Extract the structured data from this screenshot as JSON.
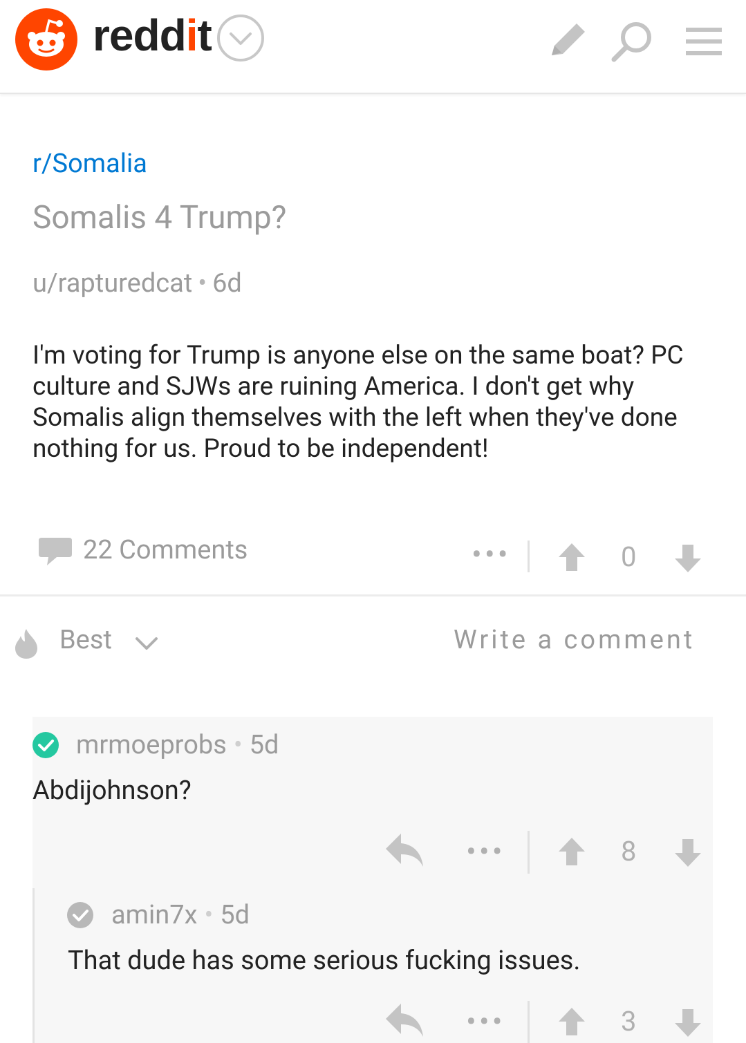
{
  "header": {
    "logo_alt": "reddit",
    "wordmark_main": "redd",
    "wordmark_i": "i",
    "wordmark_t": "t",
    "icons": [
      "reddit-alien-logo",
      "chevron-down-icon",
      "pencil-icon",
      "search-icon",
      "menu-icon"
    ]
  },
  "post": {
    "subreddit": "r/Somalia",
    "title": "Somalis 4 Trump?",
    "author": "u/rapturedcat",
    "age": "6d",
    "body": "I'm voting for Trump is anyone else on the same boat? PC culture and SJWs are ruining America. I don't get why Somalis align themselves with the left when they've done nothing for us. Proud to be independent!",
    "comments_label": "22 Comments",
    "more": "•••",
    "score": "0"
  },
  "sort": {
    "label": "Best",
    "write_comment": "Write a comment"
  },
  "comments": [
    {
      "author": "mrmoeprobs",
      "age": "5d",
      "body": "Abdijohnson?",
      "more": "•••",
      "score": "8",
      "badge_color": "#24c8a0"
    },
    {
      "author": "amin7x",
      "age": "5d",
      "body": "That dude has some serious fucking issues.",
      "more": "•••",
      "score": "3",
      "badge_color": "#b8b8b8"
    }
  ],
  "colors": {
    "brand": "#ff4500",
    "link": "#0079d3",
    "muted": "#9b9b9b",
    "icon_gray": "#c4c4c4"
  }
}
